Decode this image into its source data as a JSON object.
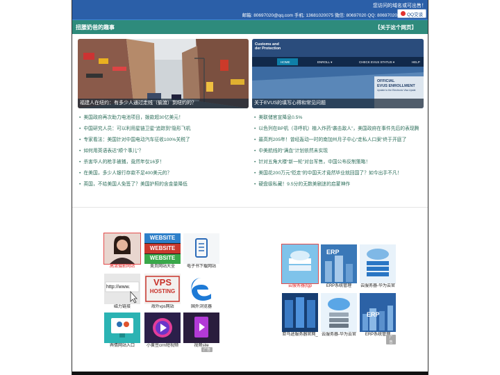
{
  "header": {
    "notice": "您访问的域名或可出售！",
    "contact_line": "邮箱: 80697020@qq.com   手机: 13681020075   微信: 80697020   QQ: 80697020",
    "qq_button": "QQ交谈"
  },
  "titlebar": {
    "title": "扭腰奶爸的趣事",
    "about": "【关于这个网页】"
  },
  "features": [
    {
      "caption": "福建人在纽约：有多少人通过走线（偷渡）到纽约的？"
    },
    {
      "caption": "关于EVUS的填写心得和常见问题",
      "inner": {
        "brand1": "Customs and",
        "brand2": "der Protection",
        "nav_home": "HOME",
        "nav_enroll": "ENROLL ▾",
        "nav_check": "CHECK EVUS STATUS ▾",
        "nav_help": "HELP",
        "official1": "OFFICIAL",
        "official2": "EVUS ENROLLMENT",
        "official3": "Update to the Electronic Visa Updat"
      }
    }
  ],
  "news_left": [
    "美国政府再次助力电池项目，拨款超30亿美元！",
    "中国研究人员：可以利用星链卫星“追踪到”隐形飞机",
    "专家看法：美国针对中国电动汽车征收100%关税了",
    "如何用英语表达“顺个事儿”？",
    "杀害华人的枪手被捕，竟然年仅16岁！",
    "在美国，多少人银行存款不足400美元的？",
    "英国，不给美国人免签了？美国护照的含金量降低"
  ],
  "news_right": [
    "美联储官宣降息0.5%",
    "以色列在BP机（寻呼机）植入炸药“袭击敌人”，美国政府在事件先后的表现腾",
    "最高判205年！曾经轰动一时的南加州月子中心“走私人口案”终于开庭了",
    "中美航线的“满血”计划依然未实现",
    "针对五角大楼“新一轮”对台军售，中国公布反制策略！",
    "美国花200万元“贬走”的中国天才竟然毕业就回国了？如今出手不凡！",
    "硬盘级私藏！9.5分的无数美剧迷的启蒙神作"
  ],
  "tiles_left": [
    {
      "label": "高清摄影网站",
      "icon": "portrait-photo"
    },
    {
      "label": "美页网站大全",
      "icon": "website-banner",
      "text": "WEBSITE"
    },
    {
      "label": "电子书下载网站",
      "icon": "ebook-icon"
    },
    {
      "label": "磁力链接",
      "icon": "cursor-url",
      "text": "http://www."
    },
    {
      "label": "海外vps网站",
      "icon": "vps-hosting",
      "text1": "VPS",
      "text2": "HOSTING"
    },
    {
      "label": "国外浏览器",
      "icon": "edge-browser"
    },
    {
      "label": "舆情网站入口",
      "icon": "monitor-people"
    },
    {
      "label": "小黄豆crm短视频",
      "icon": "video-play"
    },
    {
      "label": "视频site",
      "icon": "video-file"
    }
  ],
  "tiles_right": [
    {
      "label": "云服务器(tgp",
      "icon": "cloud-server"
    },
    {
      "label": "ERP系统管理",
      "icon": "erp-building",
      "text": "ERP"
    },
    {
      "label": "云服务器-华为云官",
      "icon": "cloud-dc"
    },
    {
      "label": "亚马逊服务器官网_",
      "icon": "server-racks"
    },
    {
      "label": "云服务器-华为云官",
      "icon": "cloud-stack"
    },
    {
      "label": "ERP系统管理",
      "icon": "erp-city",
      "text": "ERP"
    }
  ],
  "ad_label": "广告"
}
